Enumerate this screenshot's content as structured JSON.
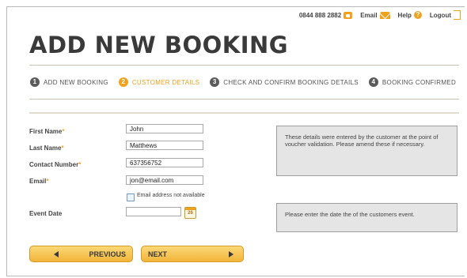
{
  "header": {
    "phone": "0844 888 2882",
    "email_label": "Email",
    "help_label": "Help",
    "help_glyph": "?",
    "logout_label": "Logout"
  },
  "title": "ADD NEW BOOKING",
  "steps": [
    {
      "num": "1",
      "label": "ADD NEW BOOKING",
      "active": false
    },
    {
      "num": "2",
      "label": "CUSTOMER DETAILS",
      "active": true
    },
    {
      "num": "3",
      "label": "CHECK AND CONFIRM BOOKING DETAILS",
      "active": false
    },
    {
      "num": "4",
      "label": "BOOKING CONFIRMED",
      "active": false
    }
  ],
  "form": {
    "first_name": {
      "label": "First Name",
      "required_mark": "*",
      "value": "John"
    },
    "last_name": {
      "label": "Last Name",
      "required_mark": "*",
      "value": "Matthews"
    },
    "contact_number": {
      "label": "Contact Number",
      "required_mark": "*",
      "value": "637356752"
    },
    "email": {
      "label": "Email",
      "required_mark": "*",
      "value": "jon@email.com"
    },
    "email_not_available_label": "Email address not available",
    "event_date": {
      "label": "Event Date",
      "value": ""
    },
    "calendar_day": "26"
  },
  "info": {
    "customer_note": "These details were entered by the customer at the point of voucher validation.  Please amend these if necessary.",
    "date_note": "Please enter the date the of the customers event."
  },
  "buttons": {
    "previous": "PREVIOUS",
    "next": "NEXT"
  },
  "colors": {
    "accent": "#f0a21e",
    "step_inactive": "#5b5b5b"
  }
}
